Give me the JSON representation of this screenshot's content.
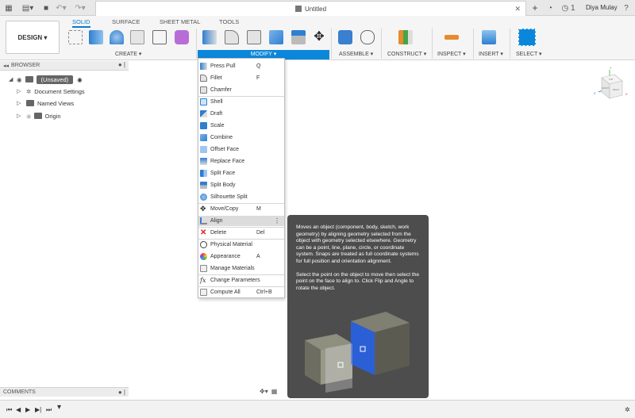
{
  "window": {
    "doc_title": "Untitled",
    "notifications": "1",
    "user_name": "Diya Mulay"
  },
  "ribbon": {
    "workspace": "DESIGN ▾",
    "tabs": [
      "SOLID",
      "SURFACE",
      "SHEET METAL",
      "TOOLS"
    ],
    "groups": [
      "CREATE ▾",
      "MODIFY ▾",
      "ASSEMBLE ▾",
      "CONSTRUCT ▾",
      "INSPECT ▾",
      "INSERT ▾",
      "SELECT ▾"
    ]
  },
  "browser": {
    "title": "BROWSER",
    "root": "(Unsaved)",
    "items": [
      "Document Settings",
      "Named Views",
      "Origin"
    ]
  },
  "menu": {
    "items": [
      {
        "label": "Press Pull",
        "shortcut": "Q"
      },
      {
        "label": "Fillet",
        "shortcut": "F"
      },
      {
        "label": "Chamfer",
        "shortcut": ""
      },
      {
        "label": "Shell",
        "shortcut": ""
      },
      {
        "label": "Draft",
        "shortcut": ""
      },
      {
        "label": "Scale",
        "shortcut": ""
      },
      {
        "label": "Combine",
        "shortcut": ""
      },
      {
        "label": "Offset Face",
        "shortcut": ""
      },
      {
        "label": "Replace Face",
        "shortcut": ""
      },
      {
        "label": "Split Face",
        "shortcut": ""
      },
      {
        "label": "Split Body",
        "shortcut": ""
      },
      {
        "label": "Silhouette Split",
        "shortcut": ""
      },
      {
        "label": "Move/Copy",
        "shortcut": "M"
      },
      {
        "label": "Align",
        "shortcut": ""
      },
      {
        "label": "Delete",
        "shortcut": "Del"
      },
      {
        "label": "Physical Material",
        "shortcut": ""
      },
      {
        "label": "Appearance",
        "shortcut": "A"
      },
      {
        "label": "Manage Materials",
        "shortcut": ""
      },
      {
        "label": "Change Parameters",
        "shortcut": ""
      },
      {
        "label": "Compute All",
        "shortcut": "Ctrl+B"
      }
    ],
    "highlighted": "Align"
  },
  "tooltip": {
    "para1": "Moves an object (component, body, sketch, work geometry) by aligning geometry selected from the object with geometry selected elsewhere. Geometry can be a point, line, plane, circle, or coordinate system. Snaps are treated as full coordinate systems for full position and orientation alignment.",
    "para2": "Select the point on the object to move then select the point on the face to align to. Click Flip and Angle to rotate the object."
  },
  "viewcube": {
    "top": "TOP",
    "front": "FRONT",
    "right": "RIGHT",
    "x": "X",
    "y": "Y",
    "z": "Z"
  },
  "comments": {
    "title": "COMMENTS"
  },
  "colors": {
    "accent": "#0a87da",
    "menu_highlight": "#dcdcdc",
    "tooltip_bg": "#4d4d4d",
    "align_face": "#2b5fd6"
  }
}
